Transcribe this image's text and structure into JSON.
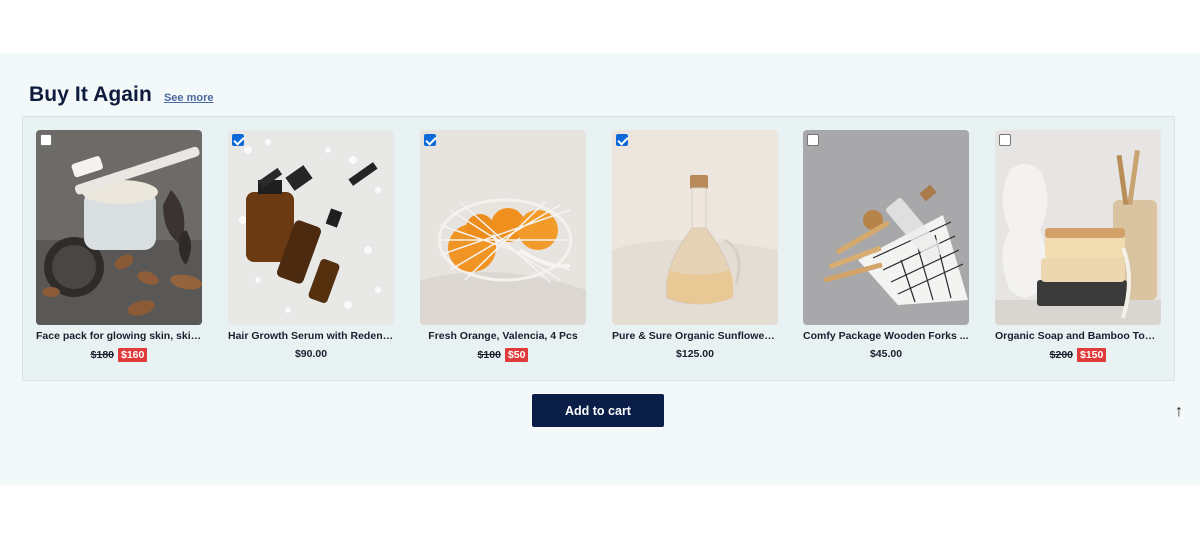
{
  "section": {
    "title": "Buy It Again",
    "see_more": "See more"
  },
  "products": [
    {
      "name": "Face pack for glowing skin, skin ...",
      "old_price": "$180",
      "price": "$160",
      "checked": false
    },
    {
      "name": "Hair Growth Serum with Redens...",
      "old_price": "",
      "price": "$90.00",
      "checked": true
    },
    {
      "name": "Fresh Orange, Valencia, 4 Pcs",
      "old_price": "$100",
      "price": "$50",
      "checked": true
    },
    {
      "name": "Pure & Sure Organic Sunflower ...",
      "old_price": "",
      "price": "$125.00",
      "checked": true
    },
    {
      "name": "Comfy Package Wooden Forks ...",
      "old_price": "",
      "price": "$45.00",
      "checked": false
    },
    {
      "name": "Organic Soap and Bamboo Toot...",
      "old_price": "$200",
      "price": "$150",
      "checked": false
    }
  ],
  "actions": {
    "add_to_cart": "Add to cart",
    "scroll_top": "↑"
  },
  "colors": {
    "accent": "#0b1e48",
    "sale": "#e03a3a",
    "checkbox": "#0b6ad8"
  }
}
